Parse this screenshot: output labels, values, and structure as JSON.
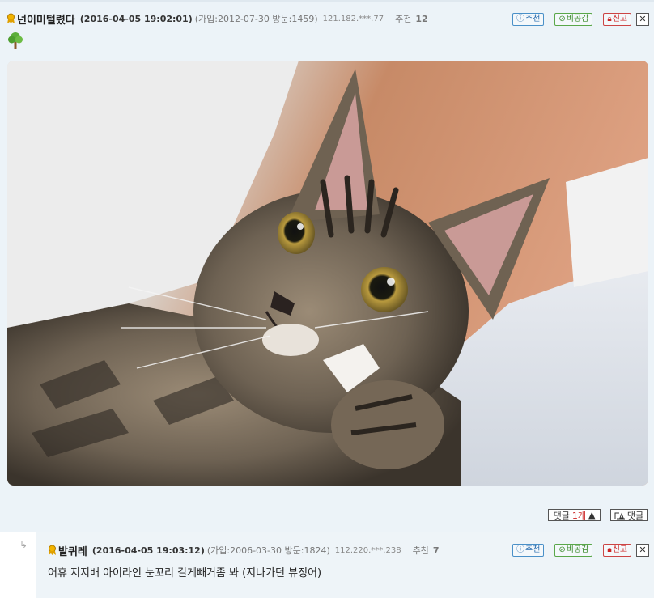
{
  "comment": {
    "nickname": "넌이미털렸다",
    "date": "(2016-04-05 19:02:01)",
    "meta": "(가입:2012-07-30 방문:1459)",
    "ip": "121.182.***.77",
    "recommend_label": "추천",
    "recommend_count": "12",
    "buttons": {
      "recommend": "추천",
      "not_agree": "비공감",
      "report": "신고"
    },
    "close": "✕"
  },
  "reply_bar": {
    "toggle_prefix": "댓글 ",
    "toggle_count": "1개",
    "toggle_arrow": "▲",
    "write": "댓글"
  },
  "reply": {
    "nickname": "발퀴레",
    "date": "(2016-04-05 19:03:12)",
    "meta": "(가입:2006-03-30 방문:1824)",
    "ip": "112.220.***.238",
    "recommend_label": "추천",
    "recommend_count": "7",
    "buttons": {
      "recommend": "추천",
      "not_agree": "비공감",
      "report": "신고"
    },
    "close": "✕",
    "text": "어휴 지지배 아이라인 눈꼬리 길게빼거좀 봐 (지나가던 뷰징어)"
  },
  "colors": {
    "background": "#ecf3f8",
    "recommend": "#2a6eb0",
    "not_agree": "#3a8a2a",
    "report": "#cc2222"
  }
}
